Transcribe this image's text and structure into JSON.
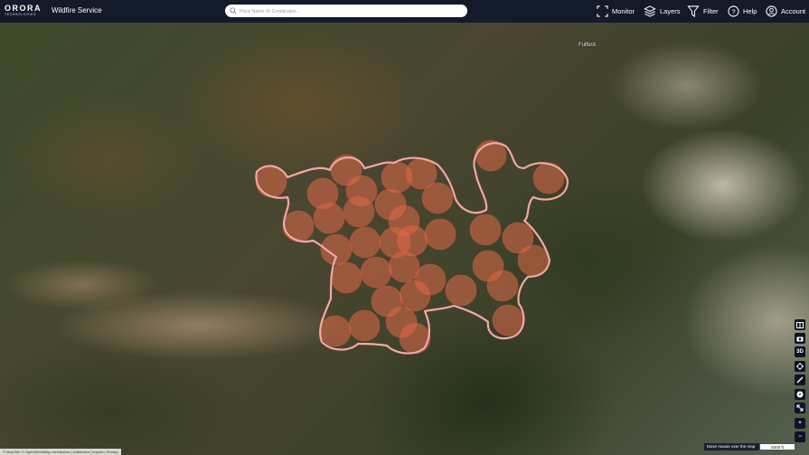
{
  "header": {
    "logo": {
      "word": "ORORA",
      "sub": "TECHNOLOGIES"
    },
    "app_title": "Wildfire Service",
    "search": {
      "placeholder": "Place Name Or Coordinates..."
    },
    "nav": [
      {
        "label": "Monitor",
        "icon": "monitor-icon"
      },
      {
        "label": "Layers",
        "icon": "layers-icon"
      },
      {
        "label": "Filter",
        "icon": "filter-icon"
      },
      {
        "label": "Help",
        "icon": "help-icon"
      },
      {
        "label": "Account",
        "icon": "account-icon"
      }
    ]
  },
  "map": {
    "place_label": "Fulford",
    "fire_color": "#e06a48",
    "perimeter_color": "#f4a7a7"
  },
  "toolbar": {
    "three_d_label": "3D",
    "zoom_in_label": "+",
    "zoom_out_label": "−",
    "tools": [
      "panel-toggle-icon",
      "camera-icon",
      "3d-icon",
      "locate-icon",
      "measure-icon",
      "compass-icon",
      "fullscreen-icon"
    ]
  },
  "footer": {
    "attribution": "© MapTiler © OpenStreetMap contributors | Attribution | Imprint | Privacy",
    "coordinates_hint": "Move mouse over the map",
    "scale_label": "5000 ft"
  },
  "colors": {
    "header_bg": "#131a2a",
    "accent": "#e06a48"
  }
}
